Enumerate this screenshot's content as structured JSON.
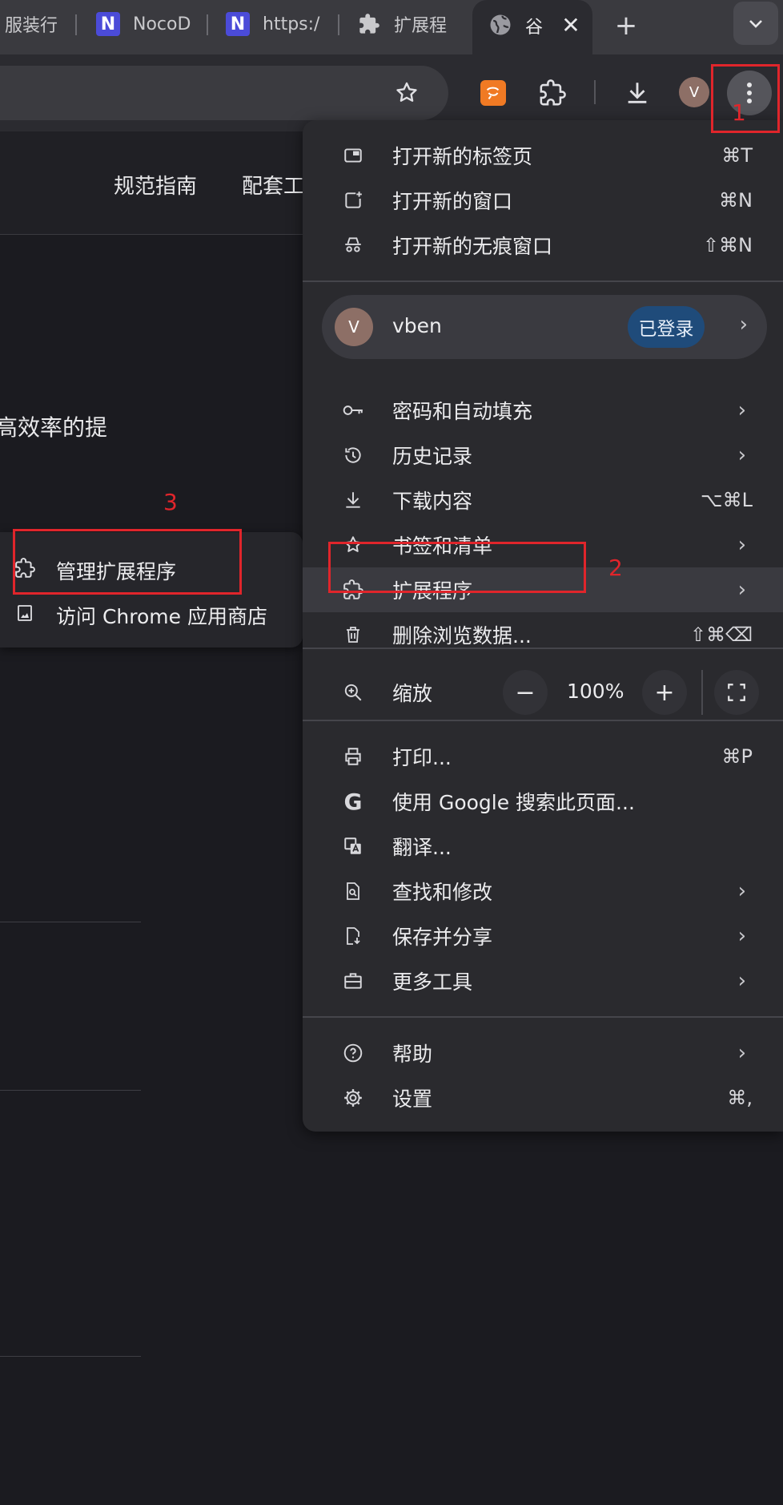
{
  "tabs": [
    {
      "label": "服装行",
      "icon": "none"
    },
    {
      "label": "NocoD",
      "icon": "nocodb-logo"
    },
    {
      "label": "https:/",
      "icon": "nocodb-logo"
    },
    {
      "label": "扩展程",
      "icon": "puzzle-icon"
    },
    {
      "label": "谷",
      "icon": "globe-icon",
      "active": true
    }
  ],
  "tab_logo_letter": "N",
  "profile_initial": "V",
  "page": {
    "nav": [
      "规范指南",
      "配套工"
    ],
    "snippet": "高效率的提"
  },
  "menu": {
    "group1": [
      {
        "label": "打开新的标签页",
        "shortcut": "⌘T",
        "icon": "new-tab-icon"
      },
      {
        "label": "打开新的窗口",
        "shortcut": "⌘N",
        "icon": "new-window-icon"
      },
      {
        "label": "打开新的无痕窗口",
        "shortcut": "⇧⌘N",
        "icon": "incognito-icon"
      }
    ],
    "profile": {
      "name": "vben",
      "status": "已登录",
      "initial": "V"
    },
    "group2": [
      {
        "label": "密码和自动填充",
        "shortcut": "",
        "icon": "key-icon",
        "submenu": true
      },
      {
        "label": "历史记录",
        "shortcut": "",
        "icon": "history-icon",
        "submenu": true
      },
      {
        "label": "下载内容",
        "shortcut": "⌥⌘L",
        "icon": "download-icon",
        "submenu": false
      },
      {
        "label": "书签和清单",
        "shortcut": "",
        "icon": "star-icon",
        "submenu": true
      },
      {
        "label": "扩展程序",
        "shortcut": "",
        "icon": "puzzle-icon",
        "submenu": true
      },
      {
        "label": "删除浏览数据...",
        "shortcut": "⇧⌘⌫",
        "icon": "trash-icon",
        "submenu": false
      }
    ],
    "zoom": {
      "label": "缩放",
      "minus": "−",
      "value": "100%",
      "plus": "+"
    },
    "group3": [
      {
        "label": "打印...",
        "shortcut": "⌘P",
        "icon": "print-icon",
        "submenu": false
      },
      {
        "label": "使用 Google 搜索此页面...",
        "shortcut": "",
        "icon": "google-icon",
        "submenu": false
      },
      {
        "label": "翻译...",
        "shortcut": "",
        "icon": "translate-icon",
        "submenu": false
      },
      {
        "label": "查找和修改",
        "shortcut": "",
        "icon": "find-icon",
        "submenu": true
      },
      {
        "label": "保存并分享",
        "shortcut": "",
        "icon": "save-share-icon",
        "submenu": true
      },
      {
        "label": "更多工具",
        "shortcut": "",
        "icon": "toolbox-icon",
        "submenu": true
      }
    ],
    "group4": [
      {
        "label": "帮助",
        "shortcut": "",
        "icon": "help-icon",
        "submenu": true
      },
      {
        "label": "设置",
        "shortcut": "⌘,",
        "icon": "settings-icon",
        "submenu": false
      }
    ]
  },
  "submenu": [
    {
      "label": "管理扩展程序",
      "icon": "puzzle-icon"
    },
    {
      "label": "访问 Chrome 应用商店",
      "icon": "store-icon"
    }
  ],
  "annotations": [
    "1",
    "2",
    "3"
  ],
  "colors": {
    "annotation": "#e0252b",
    "badge": "#1f4b7a",
    "menu_bg": "#2a2a2e"
  }
}
